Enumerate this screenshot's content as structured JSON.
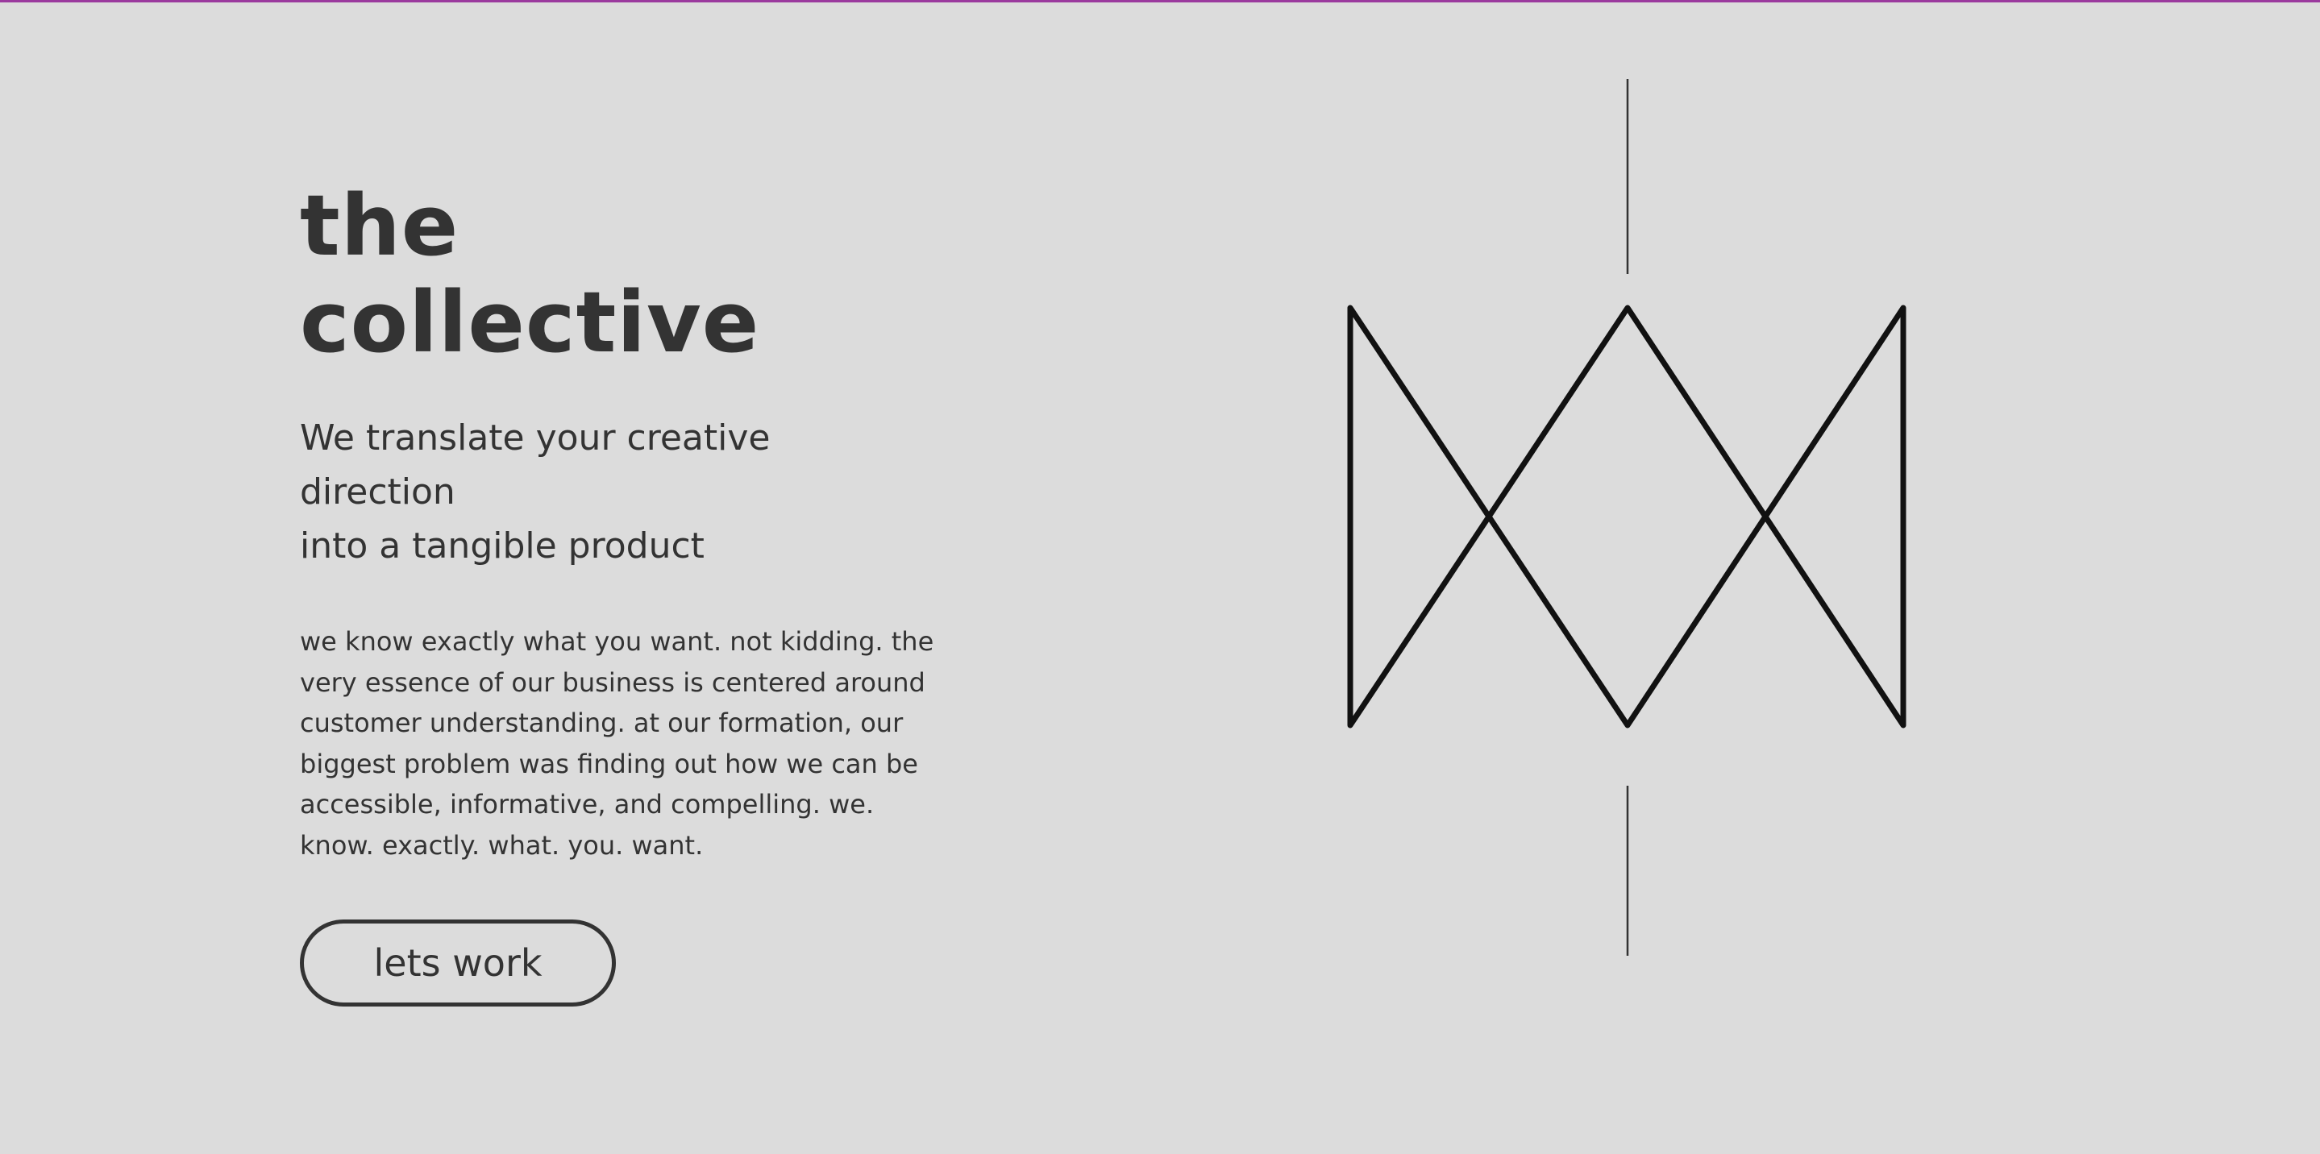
{
  "hero": {
    "title_line1": "the",
    "title_line2": "collective",
    "tagline_line1": "We translate your creative direction",
    "tagline_line2": "into a tangible product",
    "body_lines": [
      "we know exactly what you want. not kidding. the",
      "very essence of our business is centered around",
      "customer understanding. at our formation, our",
      "biggest problem was finding out how we can be",
      "accessible, informative, and compelling. we.",
      "know. exactly. what. you. want."
    ],
    "cta_label": "lets work"
  },
  "colors": {
    "background": "#dcdcdc",
    "text": "#333333",
    "top_accent": "#9b3a9e",
    "logo_stroke": "#111111"
  },
  "icons": {
    "logo": "hourglass-crossed-triangles-logo"
  }
}
